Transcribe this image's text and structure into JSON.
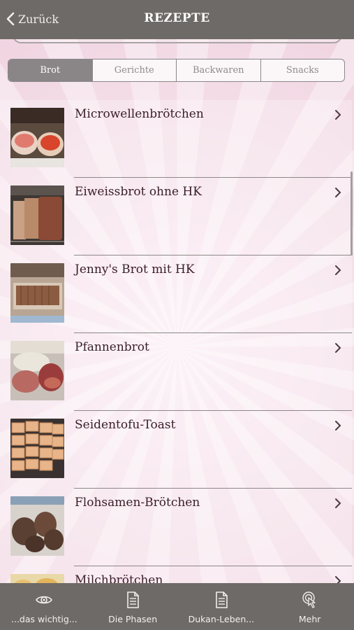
{
  "nav": {
    "back_label": "Zurück",
    "title": "REZEPTE"
  },
  "segments": [
    {
      "label": "Brot",
      "active": true
    },
    {
      "label": "Gerichte",
      "active": false
    },
    {
      "label": "Backwaren",
      "active": false
    },
    {
      "label": "Snacks",
      "active": false
    }
  ],
  "recipes": [
    {
      "title": "Microwellenbrötchen",
      "thumb": "rolls-with-salmon"
    },
    {
      "title": "Eiweissbrot ohne HK",
      "thumb": "sliced-loaf-on-rack"
    },
    {
      "title": "Jenny's Brot mit HK",
      "thumb": "bread-slices-on-tray"
    },
    {
      "title": "Pfannenbrot",
      "thumb": "flatbread-with-salami"
    },
    {
      "title": "Seidentofu-Toast",
      "thumb": "toast-squares"
    },
    {
      "title": "Flohsamen-Brötchen",
      "thumb": "dark-rolls"
    },
    {
      "title": "Milchbrötchen",
      "thumb": "milk-rolls"
    }
  ],
  "tabbar": [
    {
      "label": "...das wichtig...",
      "icon": "eye-icon"
    },
    {
      "label": "Die Phasen",
      "icon": "document-icon"
    },
    {
      "label": "Dukan-Leben...",
      "icon": "document-icon"
    },
    {
      "label": "Mehr",
      "icon": "tap-icon"
    }
  ],
  "colors": {
    "bar": "#6e6a67",
    "background": "#f6e2ec",
    "text": "#3a1d28",
    "segment_active": "#8a8587"
  }
}
